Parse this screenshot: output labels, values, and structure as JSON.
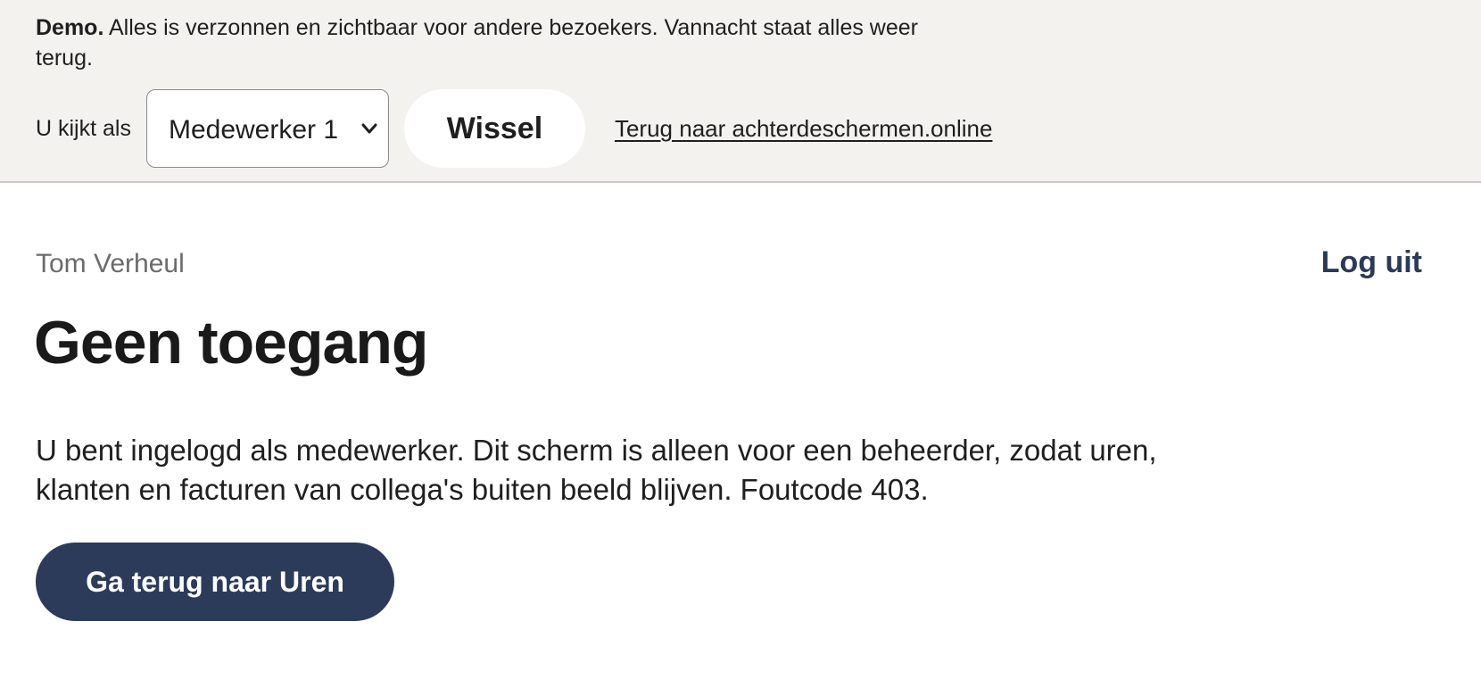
{
  "demo_banner": {
    "strong": "Demo.",
    "message": "Alles is verzonnen en zichtbaar voor andere bezoekers. Vannacht staat alles weer terug.",
    "viewer_label": "U kijkt als",
    "role_select": {
      "selected": "Medewerker 1"
    },
    "switch_label": "Wissel",
    "back_link": "Terug naar achterdeschermen.online"
  },
  "header": {
    "user_name": "Tom Verheul",
    "logout_label": "Log uit"
  },
  "main": {
    "title": "Geen toegang",
    "explanation": "U bent ingelogd als medewerker. Dit scherm is alleen voor een beheerder, zodat uren, klanten en facturen van collega's buiten beeld blijven. Foutcode 403.",
    "back_button_label": "Ga terug naar Uren"
  },
  "colors": {
    "banner_bg": "#f3f2ef",
    "accent": "#2c3b59",
    "muted_text": "#6b6b6b"
  },
  "icons": {
    "select_chevron": "chevron-down-icon"
  }
}
